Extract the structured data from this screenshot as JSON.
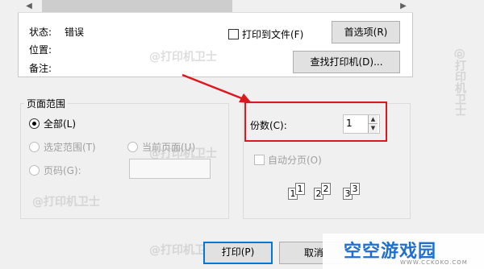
{
  "printer_section": {
    "status_label": "状态:",
    "status_value": "错误",
    "location_label": "位置:",
    "comment_label": "备注:",
    "print_to_file_label": "打印到文件(F)",
    "preferences_button": "首选项(R)",
    "find_printer_button": "查找打印机(D)..."
  },
  "page_range": {
    "legend": "页面范围",
    "all_label": "全部(L)",
    "selection_label": "选定范围(T)",
    "current_page_label": "当前页面(U)",
    "pages_label": "页码(G):",
    "pages_value": ""
  },
  "copies": {
    "label": "份数(C):",
    "value": "1",
    "collate_label": "自动分页(O)",
    "collate_icon_pages": [
      "1",
      "1",
      "2",
      "2",
      "3",
      "3"
    ]
  },
  "footer": {
    "print_button": "打印(P)",
    "cancel_button": "取消"
  },
  "watermark": {
    "text": "@打印机卫士"
  },
  "brand": {
    "name": "空空游戏园",
    "sub": "WWW.CCKOKO.COM"
  },
  "colors": {
    "annotation_red": "#e0161e",
    "accent_blue": "#0078d7",
    "brand_blue": "#1f6fd1"
  }
}
